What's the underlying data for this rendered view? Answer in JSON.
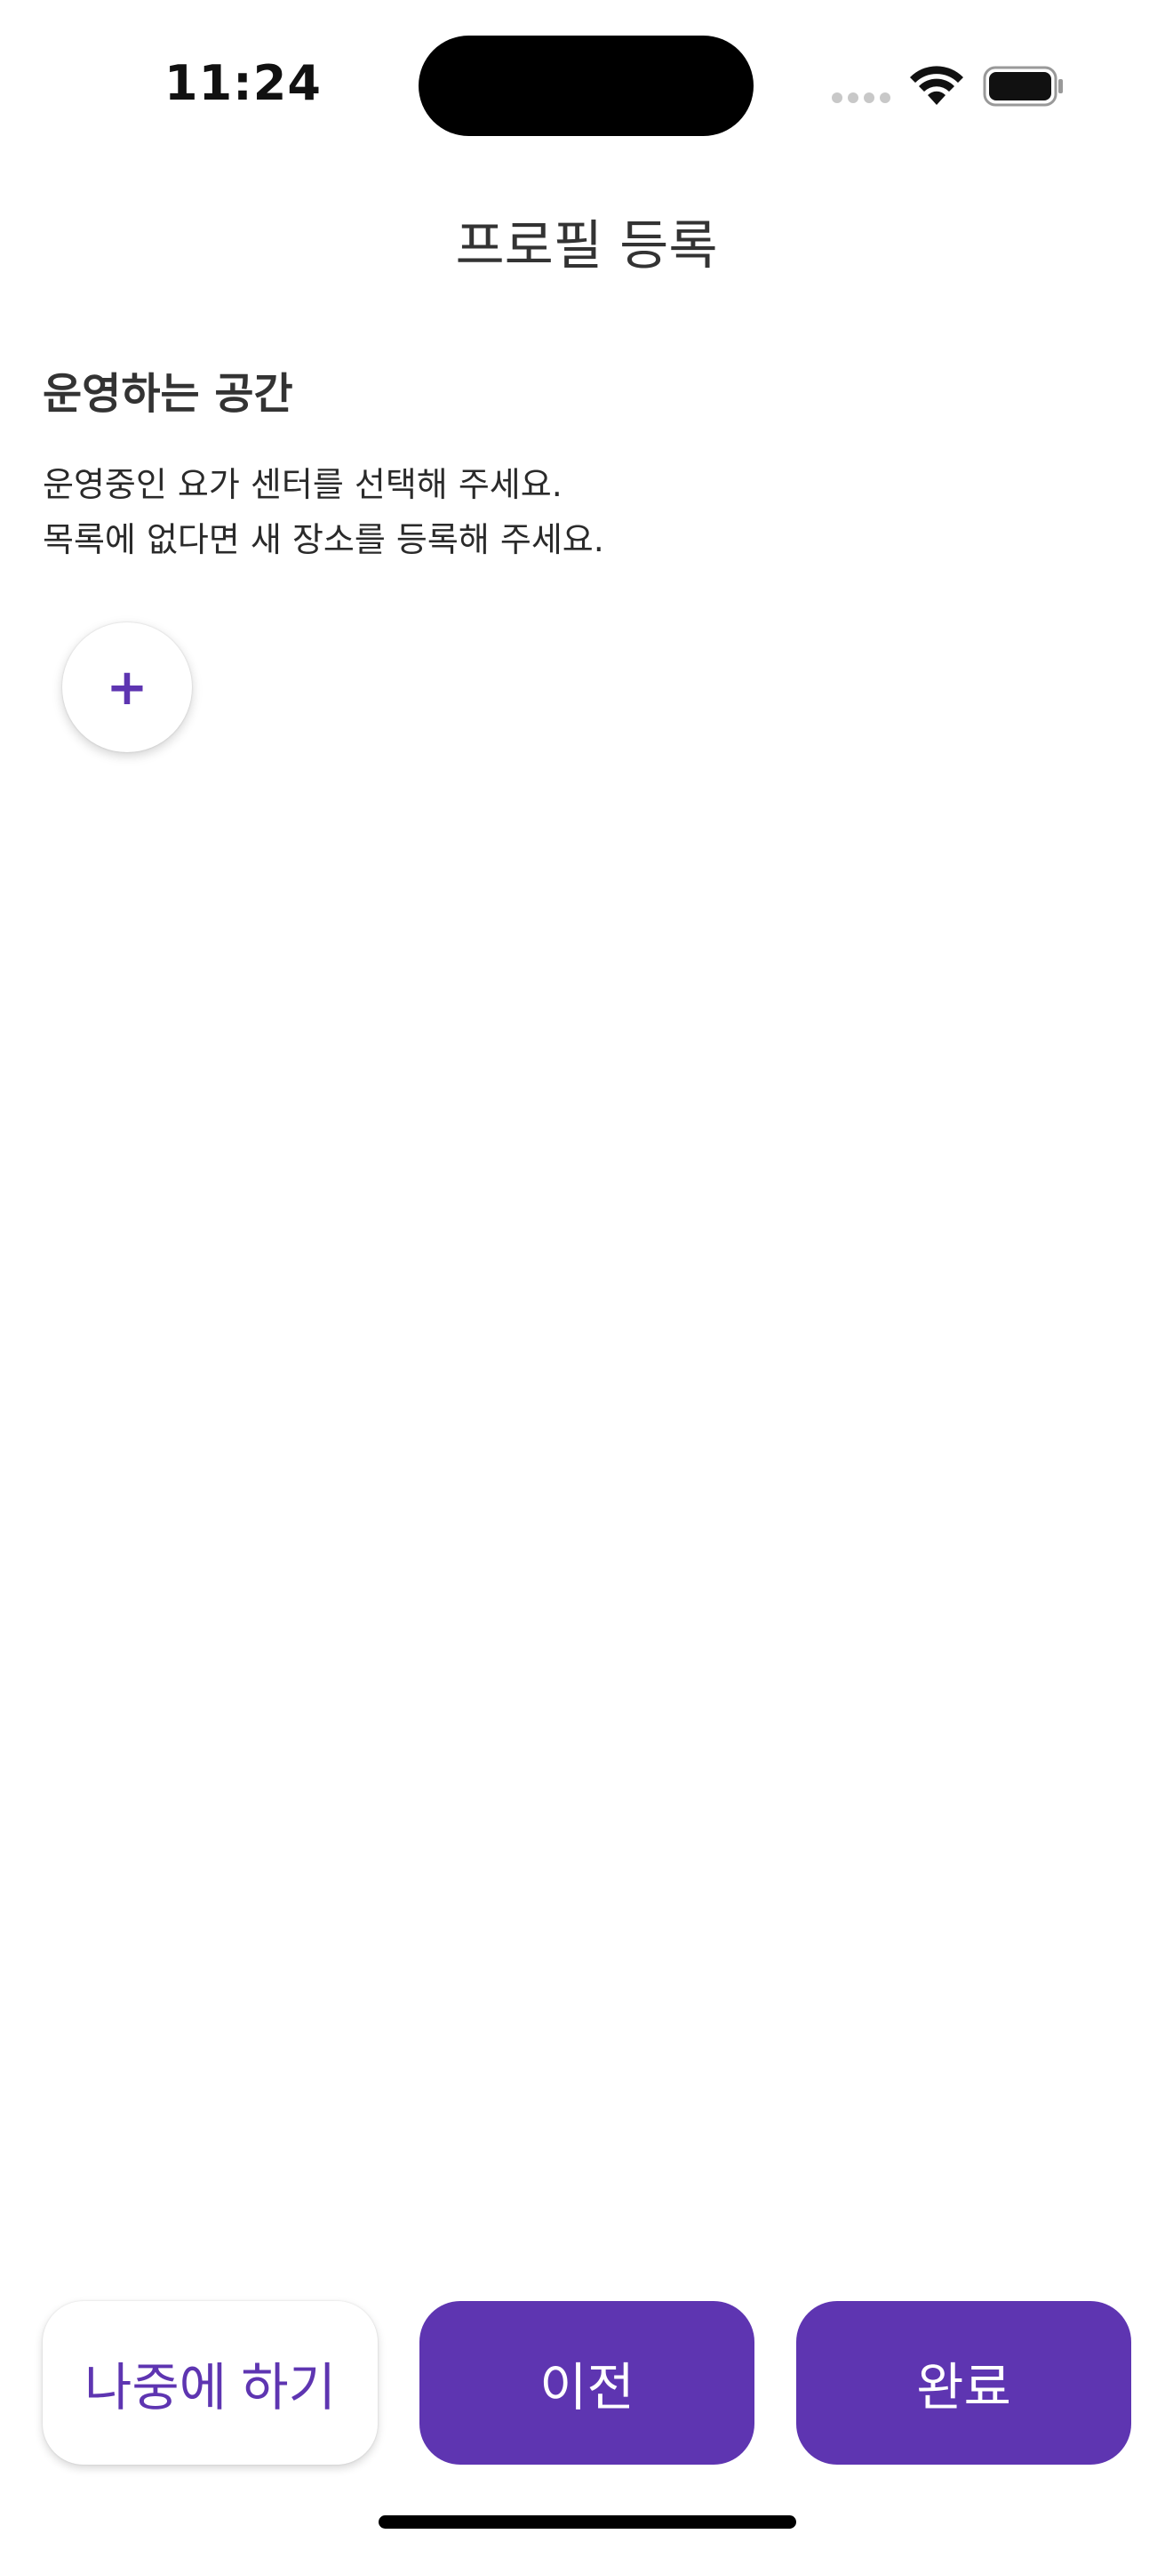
{
  "status_bar": {
    "time": "11:24",
    "icons": [
      "cellular-signal-icon",
      "wifi-icon",
      "battery-icon"
    ]
  },
  "header": {
    "title": "프로필 등록"
  },
  "section": {
    "title": "운영하는 공간",
    "description_line1": "운영중인 요가 센터를 선택해 주세요.",
    "description_line2": "목록에 없다면 새 장소를 등록해 주세요.",
    "add_button_label": "+"
  },
  "actions": {
    "later_label": "나중에 하기",
    "prev_label": "이전",
    "done_label": "완료"
  },
  "colors": {
    "accent": "#5e35b1",
    "background": "#ffffff",
    "text": "#2a2a2a"
  }
}
